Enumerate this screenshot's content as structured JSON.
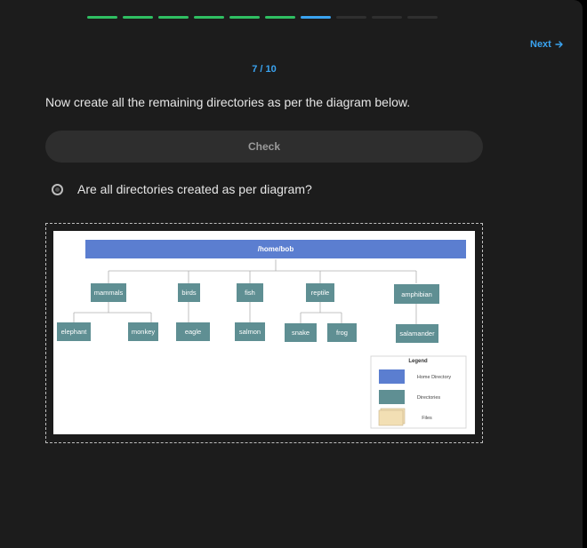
{
  "progress": {
    "total": 10,
    "completed": 6,
    "current": 7
  },
  "header": {
    "next_label": "Next",
    "counter": "7 / 10"
  },
  "question": {
    "text": "Now create all the remaining directories as per the diagram below.",
    "check_label": "Check",
    "task_label": "Are all directories created as per diagram?"
  },
  "diagram": {
    "root": "/home/bob",
    "groups": [
      {
        "name": "mammals",
        "children": [
          "elephant",
          "monkey"
        ]
      },
      {
        "name": "birds",
        "children": [
          "eagle"
        ]
      },
      {
        "name": "fish",
        "children": [
          "salmon"
        ]
      },
      {
        "name": "reptile",
        "children": [
          "snake",
          "frog"
        ]
      },
      {
        "name": "amphibian",
        "children": [
          "salamander"
        ]
      }
    ],
    "legend": {
      "title": "Legend",
      "home": "Home Directory",
      "dirs": "Directories",
      "files": "Files"
    },
    "colors": {
      "home": "#5b7ed0",
      "dir": "#5f8f93",
      "file": "#f2dfb4"
    }
  },
  "colors": {
    "accent": "#3aa3f0",
    "done": "#2fbf62",
    "background": "#1c1c1c"
  }
}
